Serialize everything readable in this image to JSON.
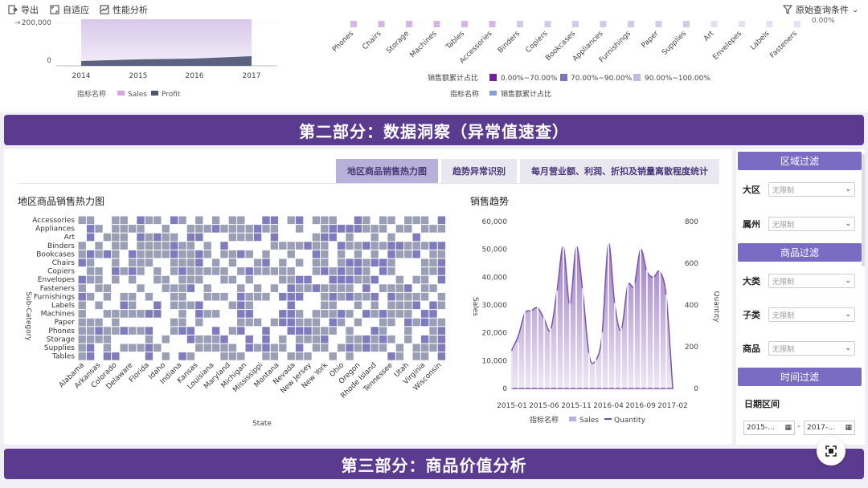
{
  "toolbar": {
    "export": "导出",
    "adaptive": "自适应",
    "perf": "性能分析",
    "query_conditions": "原始查询条件"
  },
  "top_left_chart": {
    "y_ticks": [
      "200,000",
      "0"
    ],
    "x_ticks": [
      "2014",
      "2015",
      "2016",
      "2017"
    ],
    "legend_title": "指标名称",
    "legend": [
      "Sales",
      "Profit"
    ]
  },
  "top_right_chart": {
    "categories": [
      "Phones",
      "Chairs",
      "Storage",
      "Machines",
      "Tables",
      "Accessories",
      "Binders",
      "Copiers",
      "Bookcases",
      "Appliances",
      "Furnishings",
      "Paper",
      "Supplies",
      "Art",
      "Envelopes",
      "Labels",
      "Fasteners"
    ],
    "right_tick": "0.00%",
    "legend_title": "销售额累计占比",
    "legend_ranges": [
      "0.00%~70.00%",
      "70.00%~90.00%",
      "90.00%~100.00%"
    ],
    "legend2_title": "指标名称",
    "legend2_item": "销售额累计占比"
  },
  "sections": {
    "part2": "第二部分：数据洞察（异常值速查）",
    "part3": "第三部分：商品价值分析"
  },
  "tabs": [
    "地区商品销售热力图",
    "趋势异常识别",
    "每月营业额、利润、折扣及销量离散程度统计"
  ],
  "heatmap": {
    "title": "地区商品销售热力图",
    "y_axis_label": "Sub-Category",
    "x_axis_label": "State",
    "rows": [
      "Accessories",
      "Appliances",
      "Art",
      "Binders",
      "Bookcases",
      "Chairs",
      "Copiers",
      "Envelopes",
      "Fasteners",
      "Furnishings",
      "Labels",
      "Machines",
      "Paper",
      "Phones",
      "Storage",
      "Supplies",
      "Tables"
    ],
    "x_labels": [
      "Alabama",
      "Arkansas",
      "Colorado",
      "Delaware",
      "Florida",
      "Idaho",
      "Indiana",
      "Kansas",
      "Louisiana",
      "Maryland",
      "Michigan",
      "Mississippi",
      "Montana",
      "Nevada",
      "New Jersey",
      "New York",
      "Ohio",
      "Oregon",
      "Rhode Island",
      "Tennessee",
      "Utah",
      "Virginia",
      "Wisconsin"
    ]
  },
  "trend": {
    "title": "销售趋势",
    "y_left_ticks": [
      "60,000",
      "50,000",
      "40,000",
      "30,000",
      "20,000",
      "10,000",
      "0"
    ],
    "y_right_ticks": [
      "800",
      "600",
      "400",
      "200",
      "0"
    ],
    "y_left_label": "Sales",
    "y_right_label": "Quantity",
    "x_ticks": [
      "2015-01",
      "2015-06",
      "2015-11",
      "2016-04",
      "2016-09",
      "2017-02"
    ],
    "legend_title": "指标名称",
    "legend": [
      "Sales",
      "Quantity"
    ]
  },
  "chart_data": [
    {
      "type": "area",
      "title": "",
      "xlabel": "",
      "ylabel": "",
      "x": [
        "2014",
        "2015",
        "2016",
        "2017"
      ],
      "series": [
        {
          "name": "Sales",
          "values": [
            480000,
            470000,
            610000,
            730000
          ]
        },
        {
          "name": "Profit",
          "values": [
            50000,
            60000,
            80000,
            95000
          ]
        }
      ]
    },
    {
      "type": "area",
      "title": "销售趋势",
      "xlabel": "",
      "ylabel": "Sales",
      "x": [
        "2015-01",
        "2015-02",
        "2015-03",
        "2015-04",
        "2015-05",
        "2015-06",
        "2015-07",
        "2015-08",
        "2015-09",
        "2015-10",
        "2015-11",
        "2015-12",
        "2016-01",
        "2016-02",
        "2016-03",
        "2016-04",
        "2016-05",
        "2016-06",
        "2016-07",
        "2016-08",
        "2016-09",
        "2016-10",
        "2016-11",
        "2016-12",
        "2017-01",
        "2017-02"
      ],
      "series": [
        {
          "name": "Sales",
          "values": [
            14000,
            19000,
            27000,
            28000,
            29000,
            25000,
            21000,
            35000,
            51000,
            30000,
            51000,
            35000,
            12000,
            10000,
            19000,
            52000,
            30000,
            21000,
            37000,
            37000,
            50000,
            42000,
            40000,
            42000,
            33000,
            0
          ]
        },
        {
          "name": "Quantity",
          "values": [
            180,
            220,
            370,
            390,
            420,
            350,
            290,
            470,
            690,
            410,
            690,
            480,
            170,
            140,
            270,
            700,
            410,
            290,
            510,
            510,
            680,
            570,
            550,
            570,
            450,
            0
          ]
        }
      ],
      "ylim": [
        0,
        60000
      ],
      "y2lim": [
        0,
        800
      ]
    }
  ],
  "filters": {
    "region_head": "区域过滤",
    "region_label": "大区",
    "province_label": "属州",
    "product_head": "商品过滤",
    "category_label": "大类",
    "subcategory_label": "子类",
    "product_label": "商品",
    "time_head": "时间过滤",
    "date_range_label": "日期区间",
    "placeholder": "无限制",
    "date_start": "2015-...",
    "date_sep": "-",
    "date_end": "2017-..."
  },
  "colors": {
    "banner": "#5b3b8f",
    "filter_head": "#7a6cc3",
    "heat_high": "#7f7bbd",
    "heat_mid": "#9b9fb5",
    "sales_area": "#a58bc9",
    "quantity_line": "#6d4a9c"
  }
}
